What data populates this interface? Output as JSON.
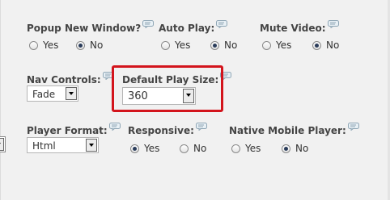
{
  "row1": {
    "popup_new_window": {
      "label": "Popup New Window?",
      "options": [
        "Yes",
        "No"
      ],
      "selected": "No"
    },
    "auto_play": {
      "label": "Auto Play:",
      "options": [
        "Yes",
        "No"
      ],
      "selected": "No"
    },
    "mute_video": {
      "label": "Mute Video:",
      "options": [
        "Yes",
        "No"
      ],
      "selected": "No"
    }
  },
  "row2": {
    "nav_controls": {
      "label": "Nav Controls:",
      "value": "Fade"
    },
    "default_play_size": {
      "label": "Default Play Size:",
      "value": "360"
    }
  },
  "row3": {
    "player_format": {
      "label": "Player Format:",
      "value": "Html"
    },
    "responsive": {
      "label": "Responsive:",
      "options": [
        "Yes",
        "No"
      ],
      "selected": "Yes"
    },
    "native_mobile_player": {
      "label": "Native Mobile Player:",
      "options": [
        "Yes",
        "No"
      ],
      "selected": "No"
    }
  },
  "icons": {
    "help": "speech-bubble-help-icon",
    "dropdown": "chevron-down-icon"
  },
  "colors": {
    "highlight_border": "#d3141c",
    "background": "#f1f1f1",
    "label_text": "#444444"
  }
}
